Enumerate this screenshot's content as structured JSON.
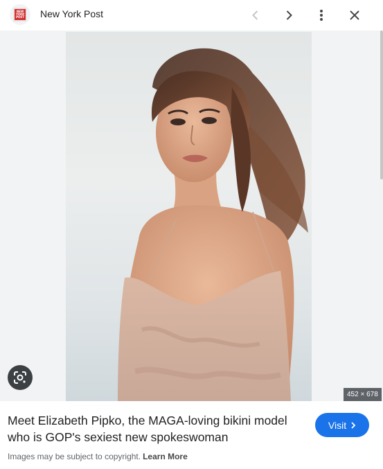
{
  "header": {
    "site_name": "New York Post",
    "favicon_text": [
      "NEW",
      "YORK",
      "POST"
    ],
    "icons": [
      "prev-chevron-icon",
      "next-chevron-icon",
      "more-vert-icon",
      "close-icon"
    ]
  },
  "viewer": {
    "image_dimensions": "452 × 678",
    "lens_icon": "google-lens-icon"
  },
  "footer": {
    "title": "Meet Elizabeth Pipko, the MAGA-loving bikini model who is GOP's sexiest new spokeswoman",
    "visit_label": "Visit",
    "copyright_text": "Images may be subject to copyright.",
    "learn_more_label": "Learn More"
  },
  "colors": {
    "accent": "#1a73e8",
    "favicon_red": "#d32f2f",
    "viewer_bg": "#f1f3f4"
  }
}
